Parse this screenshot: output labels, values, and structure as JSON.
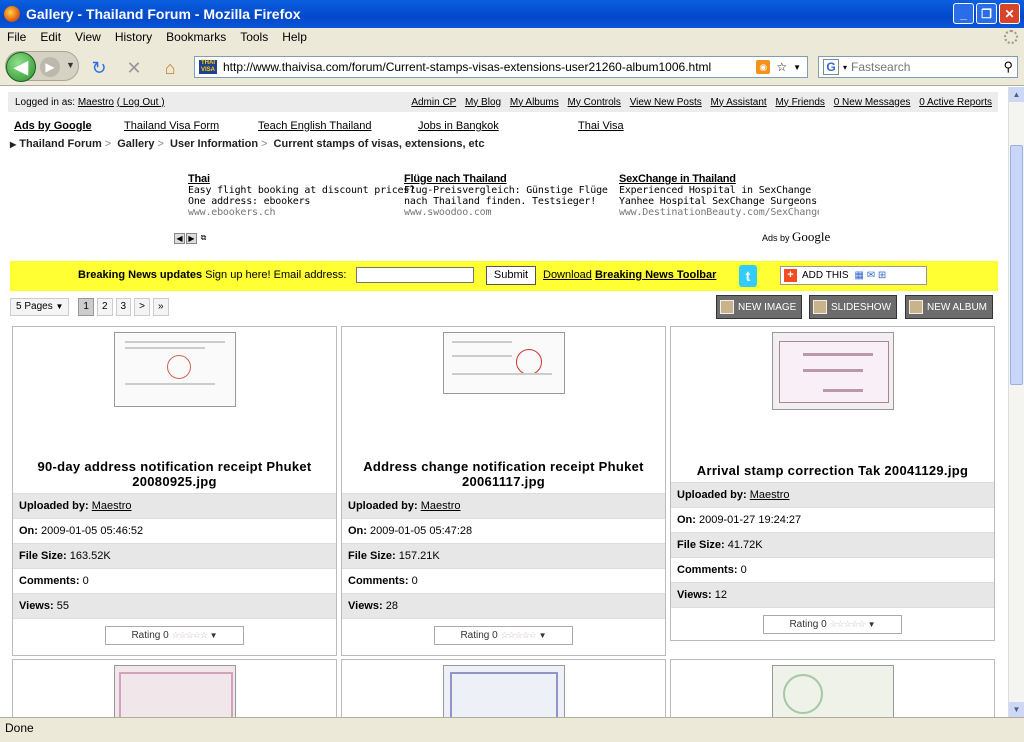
{
  "window": {
    "title": "Gallery - Thailand Forum - Mozilla Firefox"
  },
  "menu": [
    "File",
    "Edit",
    "View",
    "History",
    "Bookmarks",
    "Tools",
    "Help"
  ],
  "nav": {
    "url": "http://www.thaivisa.com/forum/Current-stamps-visas-extensions-user21260-album1006.html",
    "search_placeholder": "Fastsearch",
    "site_icon_text": "THAI VISA"
  },
  "userbar": {
    "logged_in_label": "Logged in as:",
    "user": "Maestro",
    "logout": "( Log Out )",
    "links": [
      "Admin CP",
      "My Blog",
      "My Albums",
      "My Controls",
      "View New Posts",
      "My Assistant",
      "My Friends",
      "0 New Messages",
      "0 Active Reports"
    ]
  },
  "ads_row": {
    "label": "Ads by Google",
    "links": [
      "Thailand Visa Form",
      "Teach English Thailand",
      "Jobs in Bangkok",
      "Thai Visa"
    ]
  },
  "breadcrumb": [
    "Thailand Forum",
    "Gallery",
    "User Information",
    "Current stamps of visas, extensions, etc"
  ],
  "ads": [
    {
      "title": "Thai",
      "line1": "Easy flight booking at discount prices?",
      "line2": "One address: ebookers",
      "url": "www.ebookers.ch"
    },
    {
      "title": "Flüge nach Thailand",
      "line1": "Flug-Preisvergleich: Günstige Flüge",
      "line2": "nach Thailand finden. Testsieger!",
      "url": "www.swoodoo.com"
    },
    {
      "title": "SexChange in Thailand",
      "line1": "Experienced Hospital in SexChange",
      "line2": "Yanhee Hospital SexChange Surgeons",
      "url": "www.DestinationBeauty.com/SexChange"
    }
  ],
  "ads_by": "Ads by",
  "ads_google": "Google",
  "news": {
    "bold": "Breaking News updates",
    "text": " Sign up here! Email address:",
    "submit": "Submit",
    "download": "Download",
    "toolbar": "Breaking News Toolbar",
    "addthis": "ADD THIS"
  },
  "pages": {
    "dropdown": "5 Pages",
    "items": [
      "1",
      "2",
      "3",
      ">",
      "»"
    ]
  },
  "actions": [
    "NEW IMAGE",
    "SLIDESHOW",
    "NEW ALBUM"
  ],
  "labels": {
    "uploaded": "Uploaded by:",
    "on": "On:",
    "size": "File Size:",
    "comments": "Comments:",
    "views": "Views:",
    "rating": "Rating 0"
  },
  "cards": [
    {
      "title": "90-day address notification receipt Phuket 20080925.jpg",
      "user": "Maestro",
      "on": "2009-01-05 05:46:52",
      "size": "163.52K",
      "comments": "0",
      "views": "55"
    },
    {
      "title": "Address change notification receipt Phuket 20061117.jpg",
      "user": "Maestro",
      "on": "2009-01-05 05:47:28",
      "size": "157.21K",
      "comments": "0",
      "views": "28"
    },
    {
      "title": "Arrival stamp correction Tak 20041129.jpg",
      "user": "Maestro",
      "on": "2009-01-27 19:24:27",
      "size": "41.72K",
      "comments": "0",
      "views": "12"
    }
  ],
  "status": "Done"
}
